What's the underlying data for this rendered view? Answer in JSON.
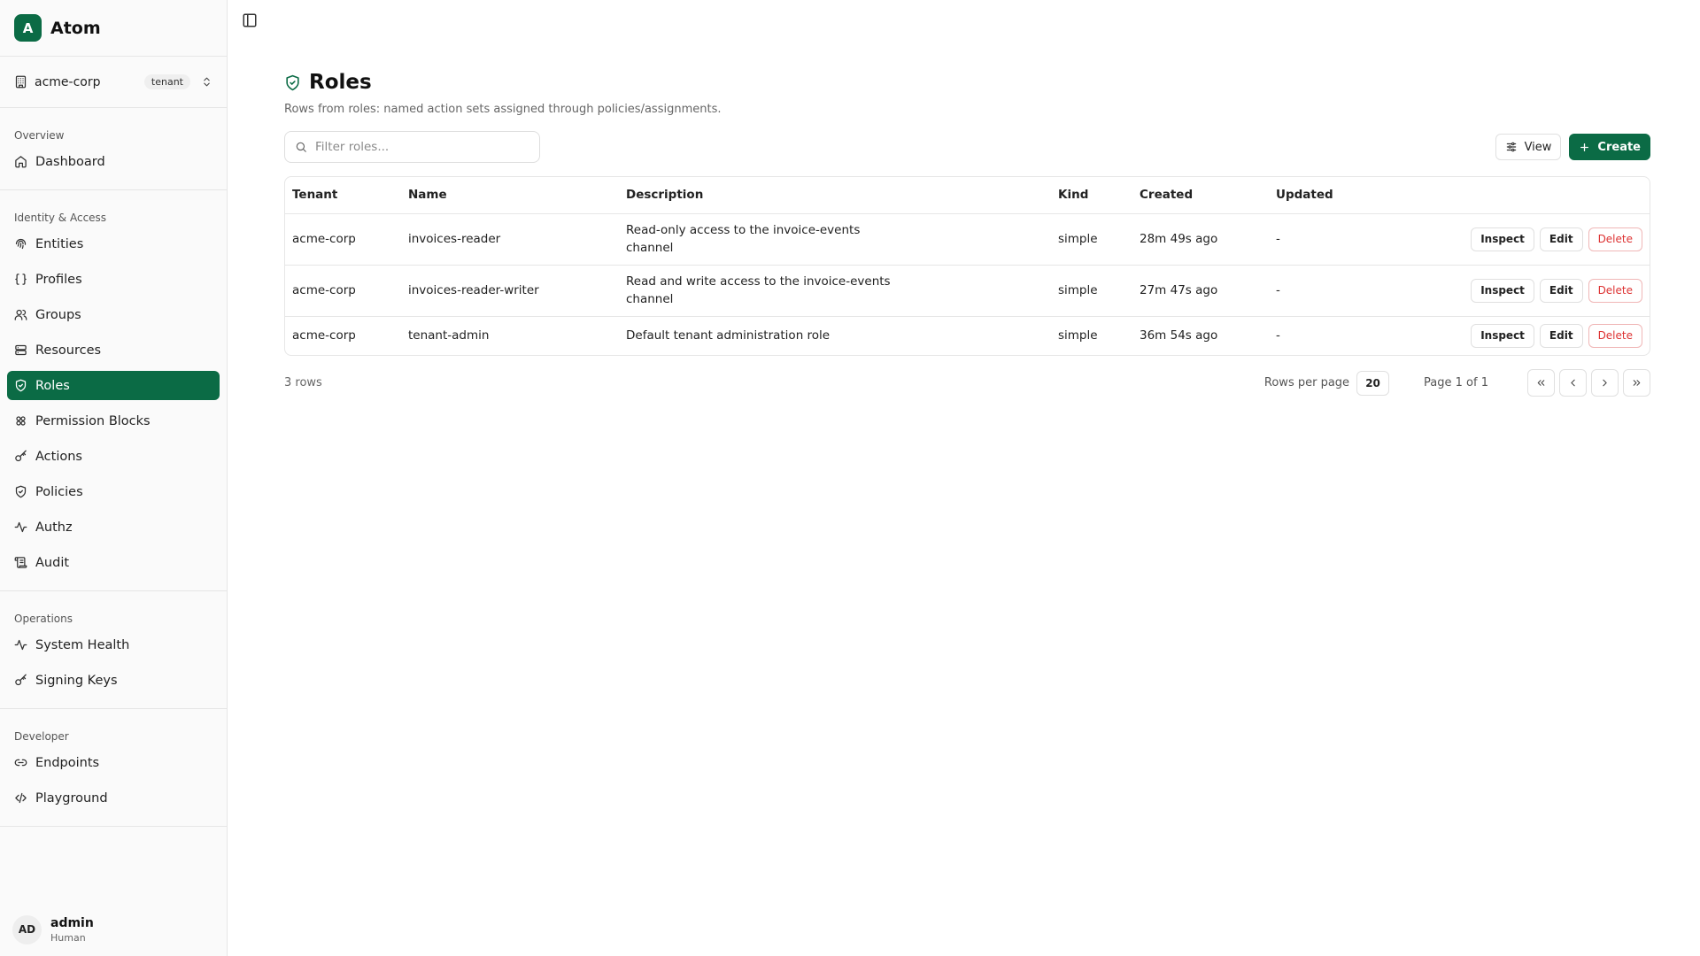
{
  "app": {
    "logo_letter": "A",
    "name": "Atom"
  },
  "tenant": {
    "name": "acme-corp",
    "badge": "tenant"
  },
  "sidebar": {
    "sections": [
      {
        "title": "Overview",
        "items": [
          {
            "label": "Dashboard",
            "icon": "home-icon"
          }
        ]
      },
      {
        "title": "Identity & Access",
        "items": [
          {
            "label": "Entities",
            "icon": "fingerprint-icon"
          },
          {
            "label": "Profiles",
            "icon": "braces-icon"
          },
          {
            "label": "Groups",
            "icon": "users-icon"
          },
          {
            "label": "Resources",
            "icon": "server-icon"
          },
          {
            "label": "Roles",
            "icon": "shield-check-icon",
            "active": true
          },
          {
            "label": "Permission Blocks",
            "icon": "blocks-icon"
          },
          {
            "label": "Actions",
            "icon": "key-icon"
          },
          {
            "label": "Policies",
            "icon": "shield-icon"
          },
          {
            "label": "Authz",
            "icon": "activity-icon"
          },
          {
            "label": "Audit",
            "icon": "scroll-icon"
          }
        ]
      },
      {
        "title": "Operations",
        "items": [
          {
            "label": "System Health",
            "icon": "activity-icon"
          },
          {
            "label": "Signing Keys",
            "icon": "key-icon"
          }
        ]
      },
      {
        "title": "Developer",
        "items": [
          {
            "label": "Endpoints",
            "icon": "link-icon"
          },
          {
            "label": "Playground",
            "icon": "code-icon"
          }
        ]
      }
    ]
  },
  "user": {
    "initials": "AD",
    "name": "admin",
    "kind": "Human"
  },
  "page": {
    "title": "Roles",
    "subtitle": "Rows from roles: named action sets assigned through policies/assignments."
  },
  "toolbar": {
    "filter_placeholder": "Filter roles...",
    "view_label": "View",
    "create_label": "Create"
  },
  "table": {
    "columns": [
      "Tenant",
      "Name",
      "Description",
      "Kind",
      "Created",
      "Updated"
    ],
    "rows": [
      {
        "tenant": "acme-corp",
        "name": "invoices-reader",
        "description": "Read-only access to the invoice-events channel",
        "kind": "simple",
        "created": "28m 49s ago",
        "updated": "-"
      },
      {
        "tenant": "acme-corp",
        "name": "invoices-reader-writer",
        "description": "Read and write access to the invoice-events channel",
        "kind": "simple",
        "created": "27m 47s ago",
        "updated": "-"
      },
      {
        "tenant": "acme-corp",
        "name": "tenant-admin",
        "description": "Default tenant administration role",
        "kind": "simple",
        "created": "36m 54s ago",
        "updated": "-"
      }
    ],
    "row_actions": {
      "inspect": "Inspect",
      "edit": "Edit",
      "delete": "Delete"
    }
  },
  "footer": {
    "row_count": "3 rows",
    "rows_per_page_label": "Rows per page",
    "rows_per_page": "20",
    "page_label": "Page 1 of 1"
  },
  "colors": {
    "accent": "#0b6b45",
    "danger": "#dd3333"
  }
}
